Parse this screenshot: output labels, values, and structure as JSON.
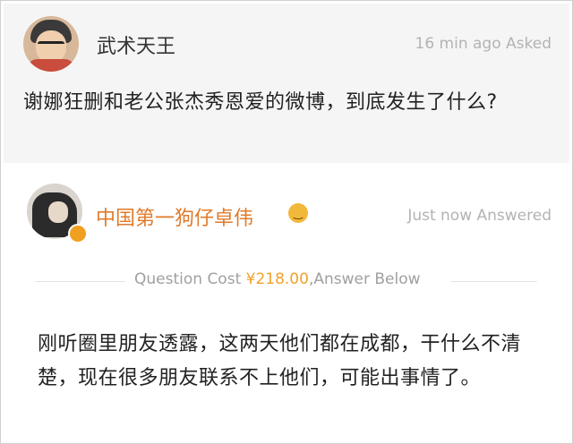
{
  "question": {
    "asker_name": "武术天王",
    "time_label": "16 min ago Asked",
    "text": "谢娜狂删和老公张杰秀恩爱的微博，到底发生了什么?"
  },
  "answer": {
    "answerer_name": "中国第一狗仔卓伟",
    "time_label": "Just now Answered",
    "cost_prefix": "Question Cost ",
    "cost_price": "¥218.00",
    "cost_suffix": ",Answer Below",
    "text": "刚听圈里朋友透露，这两天他们都在成都，干什么不清楚，现在很多朋友联系不上他们，可能出事情了。"
  },
  "colors": {
    "answerer_name": "#e07a2a",
    "price": "#f0a12a",
    "meta_gray": "#b3b3b3"
  },
  "icons": [
    "user-avatar",
    "verified-badge-icon",
    "emoji-icon"
  ]
}
